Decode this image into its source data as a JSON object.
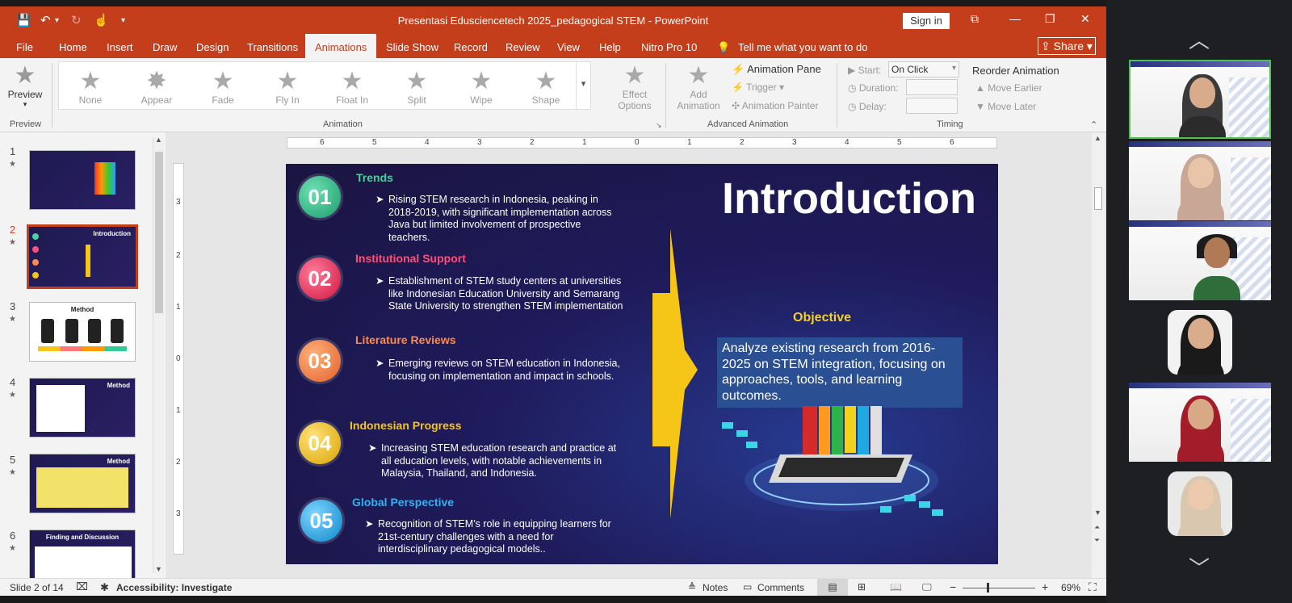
{
  "app": {
    "title": "Presentasi Edusciencetech 2025_pedagogical STEM  -  PowerPoint",
    "sign_in": "Sign in",
    "share": "Share",
    "colors": {
      "accent": "#c43e1c",
      "slide_bg": "#1f1b5c",
      "objective_box": "#2b4f93"
    }
  },
  "quick_access": {
    "save_icon": "save-icon",
    "undo_icon": "undo-icon",
    "redo_icon": "redo-icon",
    "touch_icon": "touch-mode-icon",
    "customize_icon": "customize-icon"
  },
  "tabs": [
    "File",
    "Home",
    "Insert",
    "Draw",
    "Design",
    "Transitions",
    "Animations",
    "Slide Show",
    "Record",
    "Review",
    "View",
    "Help",
    "Nitro Pro 10"
  ],
  "tell_me": "Tell me what you want to do",
  "ribbon": {
    "preview": "Preview",
    "preview_group": "Preview",
    "gallery": [
      "None",
      "Appear",
      "Fade",
      "Fly In",
      "Float In",
      "Split",
      "Wipe",
      "Shape"
    ],
    "animation_group": "Animation",
    "effect_options_1": "Effect",
    "effect_options_2": "Options",
    "add_animation_1": "Add",
    "add_animation_2": "Animation",
    "animation_pane": "Animation Pane",
    "trigger": "Trigger",
    "animation_painter": "Animation Painter",
    "advanced_group": "Advanced Animation",
    "start_label": "Start:",
    "start_value": "On Click",
    "duration_label": "Duration:",
    "delay_label": "Delay:",
    "timing_group": "Timing",
    "reorder": "Reorder Animation",
    "move_earlier": "Move Earlier",
    "move_later": "Move Later"
  },
  "thumbnails": {
    "numbers": [
      "1",
      "2",
      "3",
      "4",
      "5",
      "6"
    ],
    "captions": [
      "",
      "Introduction",
      "Method",
      "Method",
      "Method",
      "Finding and Discussion"
    ]
  },
  "ruler": {
    "h": [
      "6",
      "5",
      "4",
      "3",
      "2",
      "1",
      "0",
      "1",
      "2",
      "3",
      "4",
      "5",
      "6"
    ],
    "v": [
      "3",
      "2",
      "1",
      "0",
      "1",
      "2",
      "3"
    ]
  },
  "slide": {
    "title": "Introduction",
    "sections": [
      {
        "num": "01",
        "heading": "Trends",
        "color": "#4bd0a0",
        "text": "Rising STEM research in Indonesia, peaking in 2018-2019, with significant implementation across Java but limited involvement of prospective teachers."
      },
      {
        "num": "02",
        "heading": "Institutional Support",
        "color": "#ff4f7a",
        "text": "Establishment of STEM study centers at universities like Indonesian Education University and Semarang State University to strengthen STEM implementation"
      },
      {
        "num": "03",
        "heading": "Literature Reviews",
        "color": "#ff8a4f",
        "text": "Emerging reviews on STEM education in Indonesia, focusing on implementation and impact in schools."
      },
      {
        "num": "04",
        "heading": "Indonesian Progress",
        "color": "#f5c518",
        "text": "Increasing STEM education research and practice at all education levels, with notable achievements in Malaysia, Thailand, and Indonesia."
      },
      {
        "num": "05",
        "heading": "Global Perspective",
        "color": "#2fb3f0",
        "text": "Recognition of STEM’s role in equipping learners for 21st-century challenges with a need for interdisciplinary pedagogical models.."
      }
    ],
    "bullet_glyph": "➤",
    "objective_title": "Objective",
    "objective_text": "Analyze existing research from 2016-2025 on STEM integration, focusing on approaches, tools, and learning outcomes."
  },
  "status": {
    "slide_of": "Slide 2 of 14",
    "accessibility": "Accessibility: Investigate",
    "notes": "Notes",
    "comments": "Comments",
    "zoom_minus": "−",
    "zoom_plus": "+",
    "zoom": "69%"
  }
}
